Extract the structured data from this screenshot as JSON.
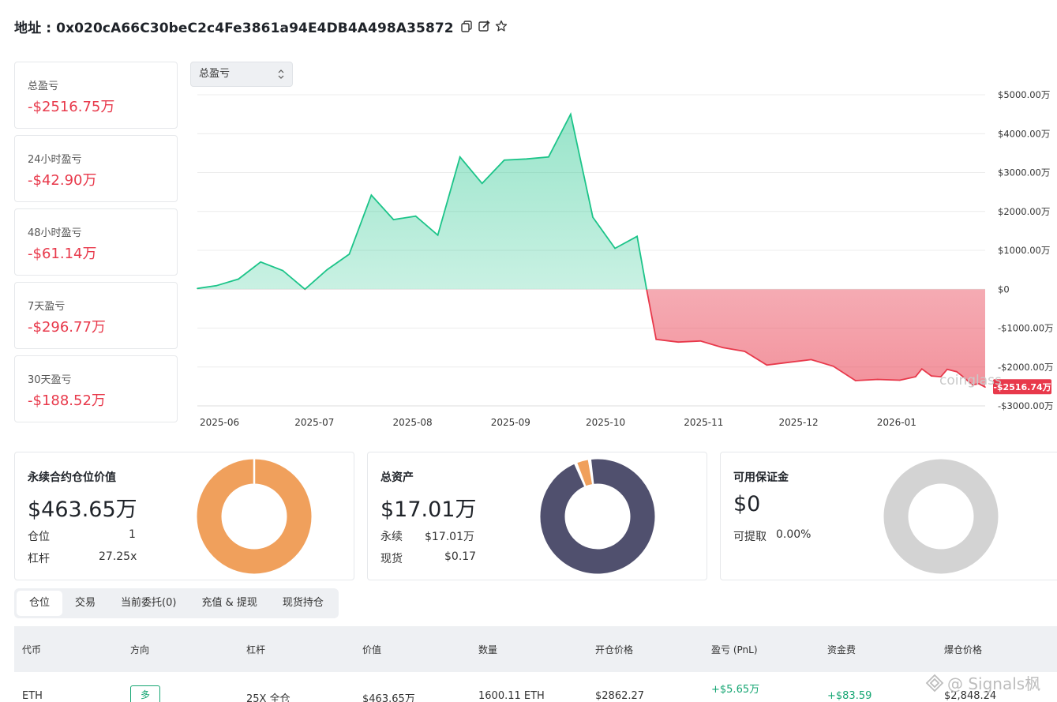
{
  "header": {
    "label": "地址 : 0x020cA66C30beC2c4Fe3861a94E4DB4A498A35872"
  },
  "stats": [
    {
      "label": "总盈亏",
      "value": "-$2516.75万"
    },
    {
      "label": "24小时盈亏",
      "value": "-$42.90万"
    },
    {
      "label": "48小时盈亏",
      "value": "-$61.14万"
    },
    {
      "label": "7天盈亏",
      "value": "-$296.77万"
    },
    {
      "label": "30天盈亏",
      "value": "-$188.52万"
    }
  ],
  "chart_select": {
    "value": "总盈亏"
  },
  "chart_data": {
    "type": "area",
    "x": [
      "2025-05-25",
      "2025-05-31",
      "2025-06-07",
      "2025-06-14",
      "2025-06-21",
      "2025-06-28",
      "2025-07-05",
      "2025-07-12",
      "2025-07-19",
      "2025-07-26",
      "2025-08-02",
      "2025-08-09",
      "2025-08-16",
      "2025-08-23",
      "2025-08-30",
      "2025-09-06",
      "2025-09-13",
      "2025-09-20",
      "2025-09-27",
      "2025-10-04",
      "2025-10-11",
      "2025-10-14",
      "2025-10-17",
      "2025-10-24",
      "2025-10-31",
      "2025-11-07",
      "2025-11-14",
      "2025-11-21",
      "2025-11-28",
      "2025-12-05",
      "2025-12-12",
      "2025-12-19",
      "2025-12-26",
      "2026-01-02",
      "2026-01-07",
      "2026-01-09",
      "2026-01-12",
      "2026-01-15",
      "2026-01-17",
      "2026-01-20",
      "2026-01-22",
      "2026-01-25",
      "2026-01-27",
      "2026-01-29"
    ],
    "values": [
      20,
      90,
      260,
      700,
      480,
      0,
      500,
      900,
      2420,
      1790,
      1880,
      1390,
      3400,
      2720,
      3320,
      3350,
      3400,
      4500,
      1850,
      1050,
      1360,
      0,
      -1290,
      -1360,
      -1330,
      -1500,
      -1600,
      -1950,
      -1880,
      -1810,
      -1980,
      -2350,
      -2320,
      -2340,
      -2250,
      -2050,
      -2230,
      -2250,
      -2060,
      -2120,
      -2250,
      -2460,
      -2430,
      -2516.74
    ],
    "xticks": [
      "2025-06",
      "2025-07",
      "2025-08",
      "2025-09",
      "2025-10",
      "2025-11",
      "2025-12",
      "2026-01"
    ],
    "yticks": [
      "$5000.00万",
      "$4000.00万",
      "$3000.00万",
      "$2000.00万",
      "$1000.00万",
      "$0",
      "-$1000.00万",
      "-$2000.00万",
      "-$3000.00万"
    ],
    "ylim": [
      -3000,
      5000
    ],
    "last_label": "-$2516.74万",
    "unit": "万",
    "positive_color": "#1cc489",
    "negative_color": "#e8394b",
    "watermark": "coinglass"
  },
  "panels": {
    "perp": {
      "title": "永续合约仓位价值",
      "value": "$463.65万",
      "rows": [
        {
          "label": "仓位",
          "value": "1"
        },
        {
          "label": "杠杆",
          "value": "27.25x"
        }
      ],
      "donut": {
        "fractions": [
          1.0
        ],
        "colors": [
          "#f0a05c"
        ]
      }
    },
    "assets": {
      "title": "总资产",
      "value": "$17.01万",
      "rows": [
        {
          "label": "永续",
          "value": "$17.01万"
        },
        {
          "label": "现货",
          "value": "$0.17"
        }
      ],
      "donut": {
        "fractions": [
          0.96,
          0.04
        ],
        "colors": [
          "#50506e",
          "#f0a05c"
        ]
      }
    },
    "margin": {
      "title": "可用保证金",
      "value": "$0",
      "rows": [
        {
          "label": "可提取",
          "value": "0.00%"
        }
      ],
      "donut": {
        "fractions": [
          1.0
        ],
        "colors": [
          "#d3d3d3"
        ]
      }
    }
  },
  "tabs": [
    "仓位",
    "交易",
    "当前委托(0)",
    "充值 & 提现",
    "现货持仓"
  ],
  "table": {
    "headers": [
      "代币",
      "方向",
      "杠杆",
      "价值",
      "数量",
      "开仓价格",
      "盈亏 (PnL)",
      "资金费",
      "爆仓价格"
    ],
    "row": {
      "token": "ETH",
      "side": "多",
      "leverage": "25X 全仓",
      "value": "$463.65万",
      "qty": "1600.11 ETH",
      "entry": "$2862.27",
      "pnl": "+$5.65万",
      "funding": "+$83.59",
      "liq": "$2,848.24"
    }
  },
  "watermark": "@ Signals枫"
}
